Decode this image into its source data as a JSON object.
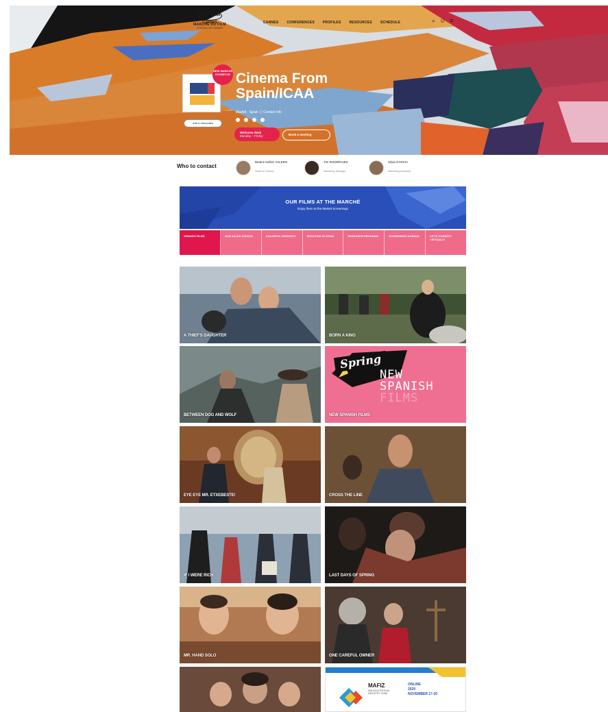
{
  "header": {
    "logo_festival": "Festival de Cannes",
    "logo_market": "MARCHÉ DU FILM",
    "logo_sub": "FESTIVAL DE CANNES",
    "nav": [
      "CANNES",
      "CONFERENCES",
      "PROFILES",
      "RESOURCES",
      "SCHEDULE"
    ],
    "tools": {
      "search": "⌕",
      "user": "☺",
      "menu": "≡"
    }
  },
  "company": {
    "badge": "NEW MARCHÉ EXHIBITOR",
    "title": "Cinema From Spain/ICAA",
    "meta": "Madrid · Spain  ⓘ  Contact info",
    "social_count": 4,
    "left_pill": "Add to favourites",
    "cta_primary_line1": "Welcome desk",
    "cta_primary_line2": "Monday – Friday",
    "cta_secondary": "Book a meeting"
  },
  "contacts": {
    "label": "Who to contact",
    "people": [
      {
        "name": "Beatriz Núñez VALERO",
        "role": "Head of Cinema"
      },
      {
        "name": "Tim RODRÍGUEZ",
        "role": "Marketing Manager"
      },
      {
        "name": "Silvia GARCÍA",
        "role": "Marketing Assistant"
      }
    ]
  },
  "banner": {
    "title": "OUR FILMS AT THE MARCHÉ",
    "subtitle": "Enjoy them at the Market Screenings"
  },
  "tabs": [
    {
      "label": "SPANISH FILMS",
      "active": true
    },
    {
      "label": "OUR SALES AGENTS",
      "active": false
    },
    {
      "label": "COLORFUL DIVERSITY",
      "active": false
    },
    {
      "label": "SHOOTING IN SPAIN",
      "active": false
    },
    {
      "label": "RESEARCH PROGRAM",
      "active": false
    },
    {
      "label": "SCREENINGS AGENDA",
      "active": false
    },
    {
      "label": "LET'S CONNECT VIRTUALLY",
      "active": false
    }
  ],
  "films": [
    {
      "title": "A THIEF'S DAUGHTER"
    },
    {
      "title": "BORN A KING"
    },
    {
      "title": "BETWEEN DOG AND WOLF"
    },
    {
      "title": "NEW SPANISH FILMS"
    },
    {
      "title": "EYE EYE MR. ETXEBESTE!"
    },
    {
      "title": "CROSS THE LINE"
    },
    {
      "title": "IF I WERE RICH"
    },
    {
      "title": "LAST DAYS OF SPRING"
    },
    {
      "title": "MR. HAND SOLO"
    },
    {
      "title": "ONE CAREFUL OWNER"
    }
  ],
  "spring_card": {
    "logo": "Spring",
    "line1": "NEW",
    "line2": "SPANISH",
    "line3": "FILMS"
  },
  "mafiz": {
    "name": "MAFIZ",
    "sub": "MÁLAGA FESTIVAL INDUSTRY ZONE",
    "right1": "ONLINE",
    "right2": "2020",
    "right3": "NOVEMBER 17-20"
  },
  "colors": {
    "accent_pink": "#e5224b",
    "tab_pink": "#f06a8a",
    "banner_blue": "#2a4fb8"
  }
}
